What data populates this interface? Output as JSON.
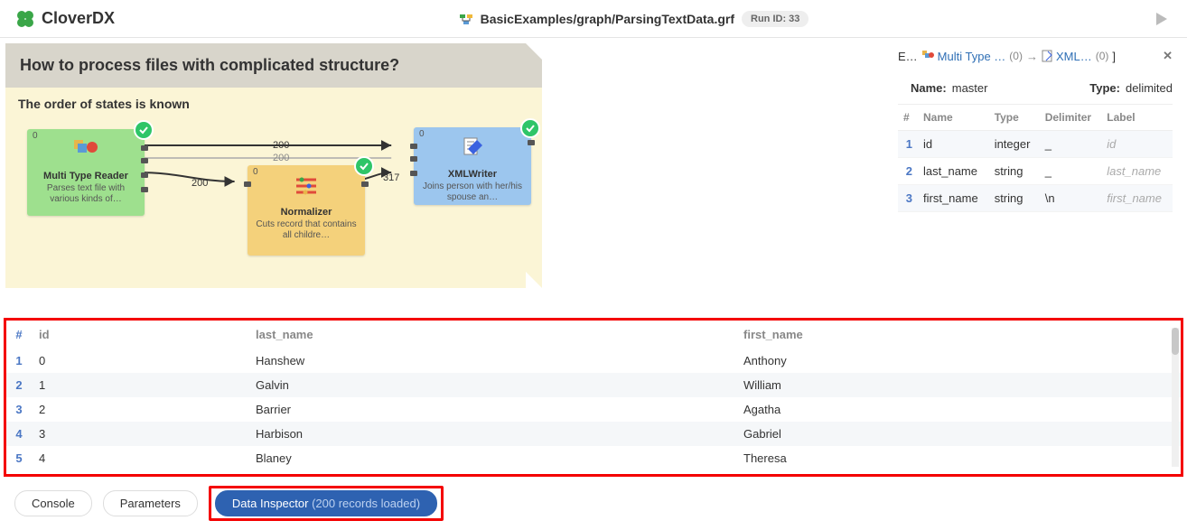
{
  "header": {
    "app_name": "CloverDX",
    "file_path": "BasicExamples/graph/ParsingTextData.grf",
    "run_id_label": "Run ID: 33"
  },
  "note": {
    "title": "How to process files with complicated structure?",
    "subtitle": "The order of states is known"
  },
  "nodes": {
    "reader": {
      "idx": "0",
      "title": "Multi Type Reader",
      "sub": "Parses text file with various kinds of…"
    },
    "normalizer": {
      "idx": "0",
      "title": "Normalizer",
      "sub": "Cuts record that contains all childre…"
    },
    "writer": {
      "idx": "0",
      "title": "XMLWriter",
      "sub": "Joins person with her/his spouse an…"
    }
  },
  "edges": {
    "e1": "200",
    "e2": "200",
    "e3": "200",
    "e4": "317"
  },
  "inspector_cols": {
    "c0": "#",
    "c1": "id",
    "c2": "last_name",
    "c3": "first_name"
  },
  "inspector_rows": [
    {
      "n": "1",
      "id": "0",
      "last": "Hanshew",
      "first": "Anthony"
    },
    {
      "n": "2",
      "id": "1",
      "last": "Galvin",
      "first": "William"
    },
    {
      "n": "3",
      "id": "2",
      "last": "Barrier",
      "first": "Agatha"
    },
    {
      "n": "4",
      "id": "3",
      "last": "Harbison",
      "first": "Gabriel"
    },
    {
      "n": "5",
      "id": "4",
      "last": "Blaney",
      "first": "Theresa"
    }
  ],
  "right_panel": {
    "e_label": "E…",
    "link1": "Multi Type …",
    "count1": "(0)",
    "arrow": "→",
    "link2": "XML…",
    "count2": "(0)",
    "bracket": "]",
    "name_label": "Name:",
    "name_value": "master",
    "type_label": "Type:",
    "type_value": "delimited",
    "cols": {
      "c0": "#",
      "c1": "Name",
      "c2": "Type",
      "c3": "Delimiter",
      "c4": "Label"
    },
    "rows": [
      {
        "n": "1",
        "name": "id",
        "type": "integer",
        "delim": "_",
        "label": "id"
      },
      {
        "n": "2",
        "name": "last_name",
        "type": "string",
        "delim": "_",
        "label": "last_name"
      },
      {
        "n": "3",
        "name": "first_name",
        "type": "string",
        "delim": "\\n",
        "label": "first_name"
      }
    ]
  },
  "tabs": {
    "console": "Console",
    "parameters": "Parameters",
    "data_inspector": "Data Inspector",
    "di_suffix": " (200 records loaded)"
  }
}
